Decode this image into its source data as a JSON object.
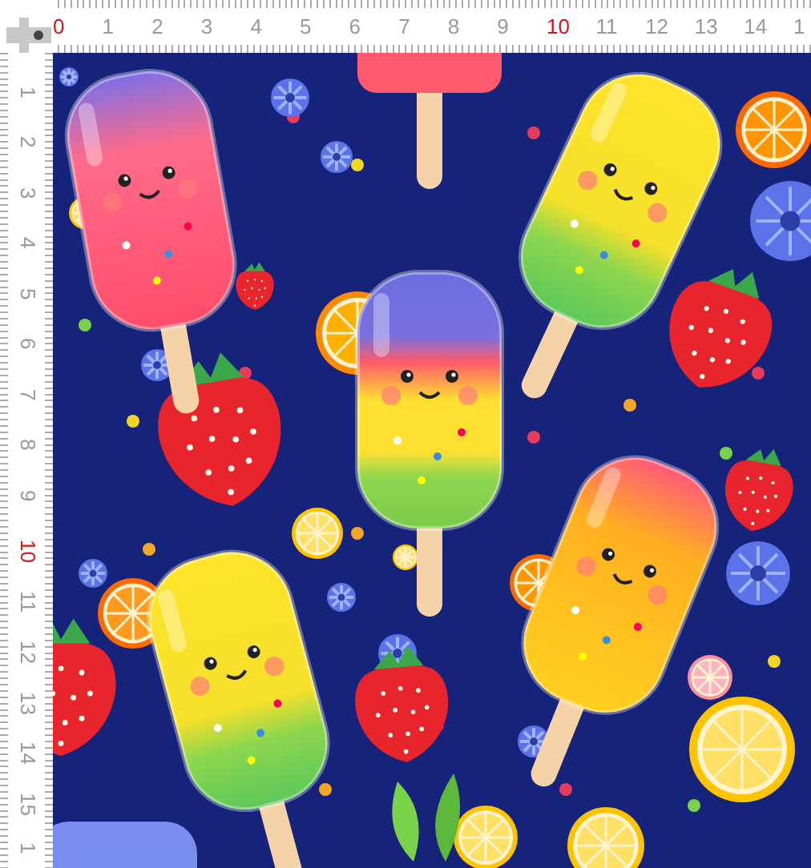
{
  "ruler_top": {
    "labels": [
      {
        "text": "0",
        "highlight": true
      },
      {
        "text": "1",
        "highlight": false
      },
      {
        "text": "2",
        "highlight": false
      },
      {
        "text": "3",
        "highlight": false
      },
      {
        "text": "4",
        "highlight": false
      },
      {
        "text": "5",
        "highlight": false
      },
      {
        "text": "6",
        "highlight": false
      },
      {
        "text": "7",
        "highlight": false
      },
      {
        "text": "8",
        "highlight": false
      },
      {
        "text": "9",
        "highlight": false
      },
      {
        "text": "10",
        "highlight": true
      },
      {
        "text": "11",
        "highlight": false
      },
      {
        "text": "12",
        "highlight": false
      },
      {
        "text": "13",
        "highlight": false
      },
      {
        "text": "14",
        "highlight": false
      },
      {
        "text": "1",
        "highlight": false
      }
    ]
  },
  "ruler_left": {
    "labels": [
      {
        "text": "1",
        "highlight": false
      },
      {
        "text": "2",
        "highlight": false
      },
      {
        "text": "3",
        "highlight": false
      },
      {
        "text": "4",
        "highlight": false
      },
      {
        "text": "5",
        "highlight": false
      },
      {
        "text": "6",
        "highlight": false
      },
      {
        "text": "7",
        "highlight": false
      },
      {
        "text": "8",
        "highlight": false
      },
      {
        "text": "9",
        "highlight": false
      },
      {
        "text": "10",
        "highlight": true
      },
      {
        "text": "11",
        "highlight": false
      },
      {
        "text": "12",
        "highlight": false
      },
      {
        "text": "13",
        "highlight": false
      },
      {
        "text": "14",
        "highlight": false
      },
      {
        "text": "15",
        "highlight": false
      },
      {
        "text": "1",
        "highlight": false
      }
    ]
  }
}
